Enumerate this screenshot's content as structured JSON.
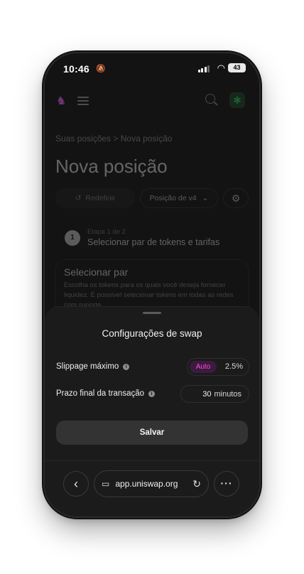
{
  "status": {
    "time": "10:46",
    "battery": "43"
  },
  "app": {
    "breadcrumb": "Suas posições  >  Nova posição",
    "title": "Nova posição",
    "reset_label": "Redefinir",
    "position_label": "Posição de v4",
    "step_small": "Etapa 1 de 2",
    "step_number": "1",
    "step_main": "Selecionar par de tokens e tarifas",
    "card_title": "Selecionar par",
    "card_text": "Escolha os tokens para os quais você deseja fornecer liquidez. É possível selecionar tokens em todas as redes com suporte."
  },
  "sheet": {
    "title": "Configurações de swap",
    "slippage_label": "Slippage máximo",
    "slippage_mode": "Auto",
    "slippage_value": "2.5%",
    "deadline_label": "Prazo final da transação",
    "deadline_value": "30",
    "deadline_unit": "minutos",
    "save_label": "Salvar"
  },
  "browser": {
    "url": "app.uniswap.org"
  },
  "colors": {
    "accent": "#ff4dd8",
    "background": "#131313",
    "sheet": "#1b1b1b"
  },
  "icons": [
    "bell-slash-icon",
    "signal-icon",
    "wifi-icon",
    "battery-icon",
    "uniswap-logo-icon",
    "menu-icon",
    "search-icon",
    "reset-icon",
    "chevron-down-icon",
    "gear-icon",
    "info-icon",
    "back-icon",
    "page-icon",
    "reload-icon",
    "more-icon"
  ]
}
